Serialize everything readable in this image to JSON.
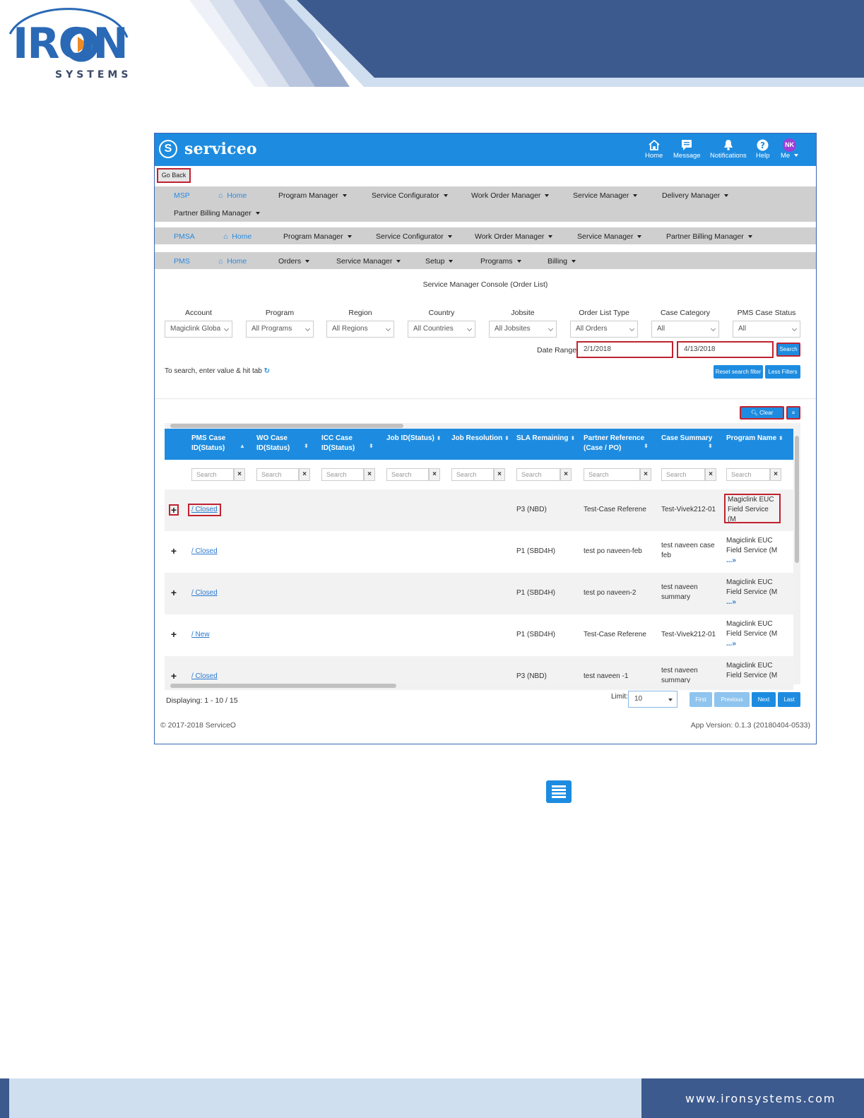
{
  "doc": {
    "logo_word": "IRON",
    "logo_sub": "SYSTEMS",
    "footer_site": "www.ironsystems.com",
    "colors": {
      "brand_blue": "#3d5a8e",
      "light_blue": "#cfdff0"
    }
  },
  "app": {
    "brand": "serviceo",
    "brand_icon": "serviceo-s-logo",
    "colors": {
      "primary": "#1d8ce0",
      "highlight_border": "#c0222f",
      "menubar": "#cfcfcf",
      "avatar": "#9b3fd8"
    },
    "top_nav": [
      {
        "label": "Home",
        "icon": "home-icon"
      },
      {
        "label": "Message",
        "icon": "message-icon"
      },
      {
        "label": "Notifications",
        "icon": "bell-icon"
      },
      {
        "label": "Help",
        "icon": "help-icon"
      },
      {
        "label": "Me",
        "avatar": "NK"
      }
    ],
    "go_back": "Go Back",
    "msp_menu": {
      "section": "MSP",
      "home": "Home",
      "items": [
        "Program Manager",
        "Service Configurator",
        "Work Order Manager",
        "Service Manager",
        "Delivery Manager",
        "Partner Billing Manager"
      ]
    },
    "pmsa_menu": {
      "section": "PMSA",
      "home": "Home",
      "items": [
        "Program Manager",
        "Service Configurator",
        "Work Order Manager",
        "Service Manager",
        "Partner Billing Manager"
      ]
    },
    "pms_menu": {
      "section": "PMS",
      "home": "Home",
      "items": [
        "Orders",
        "Service Manager",
        "Setup",
        "Programs",
        "Billing"
      ]
    },
    "console_title": "Service Manager Console (Order List)",
    "filters": [
      {
        "label": "Account",
        "value": "Magiclink Globa"
      },
      {
        "label": "Program",
        "value": "All Programs"
      },
      {
        "label": "Region",
        "value": "All Regions"
      },
      {
        "label": "Country",
        "value": "All Countries"
      },
      {
        "label": "Jobsite",
        "value": "All Jobsites"
      },
      {
        "label": "Order List Type",
        "value": "All Orders"
      },
      {
        "label": "Case Category",
        "value": "All"
      },
      {
        "label": "PMS Case Status",
        "value": "All"
      }
    ],
    "date_range": {
      "label": "Date Range:",
      "from": "2/1/2018",
      "to": "4/13/2018",
      "search": "Search"
    },
    "hint": "To search, enter value & hit tab",
    "reset_filter": "Reset search filter",
    "less_filters": "Less Filters",
    "clear_search": "Clear Search",
    "columns": [
      {
        "line1": "PMS Case",
        "line2": "ID(Status)"
      },
      {
        "line1": "WO Case",
        "line2": "ID(Status)"
      },
      {
        "line1": "ICC Case",
        "line2": "ID(Status)"
      },
      {
        "line1": "Job ID(Status)",
        "line2": ""
      },
      {
        "line1": "Job Resolution",
        "line2": ""
      },
      {
        "line1": "SLA Remaining",
        "line2": ""
      },
      {
        "line1": "Partner Reference",
        "line2": "(Case / PO)"
      },
      {
        "line1": "Case Summary",
        "line2": ""
      },
      {
        "line1": "Program Name",
        "line2": ""
      }
    ],
    "search_placeholder": "Search",
    "rows": [
      {
        "status": "/ Closed",
        "sla": "P3 (NBD)",
        "partner_ref": "Test-Case Referene",
        "summary_1": "Test-Vivek212-01",
        "summary_2": "",
        "program_1": "Magiclink EUC",
        "program_2": "Field Service (M",
        "more": "...»"
      },
      {
        "status": "/ Closed",
        "sla": "P1 (SBD4H)",
        "partner_ref": "test po naveen-feb",
        "summary_1": "test naveen case",
        "summary_2": "feb",
        "program_1": "Magiclink EUC",
        "program_2": "Field Service (M",
        "more": "...»"
      },
      {
        "status": "/ Closed",
        "sla": "P1 (SBD4H)",
        "partner_ref": "test po naveen-2",
        "summary_1": "test naveen",
        "summary_2": "summary",
        "program_1": "Magiclink EUC",
        "program_2": "Field Service (M",
        "more": "...»"
      },
      {
        "status": "/ New",
        "sla": "P1 (SBD4H)",
        "partner_ref": "Test-Case Referene",
        "summary_1": "Test-Vivek212-01",
        "summary_2": "",
        "program_1": "Magiclink EUC",
        "program_2": "Field Service (M",
        "more": "...»"
      },
      {
        "status": "/ Closed",
        "sla": "P3 (NBD)",
        "partner_ref": "test naveen -1",
        "summary_1": "test naveen",
        "summary_2": "summary",
        "program_1": "Magiclink EUC",
        "program_2": "Field Service (M",
        "more": "...»"
      }
    ],
    "displaying": "Displaying: 1 - 10 / 15",
    "limit_label": "Limit:",
    "limit_value": "10",
    "pager": [
      "First",
      "Previous",
      "Next",
      "Last"
    ],
    "copyright": "© 2017-2018 ServiceO",
    "app_version": "App Version: 0.1.3 (20180404-0533)"
  }
}
